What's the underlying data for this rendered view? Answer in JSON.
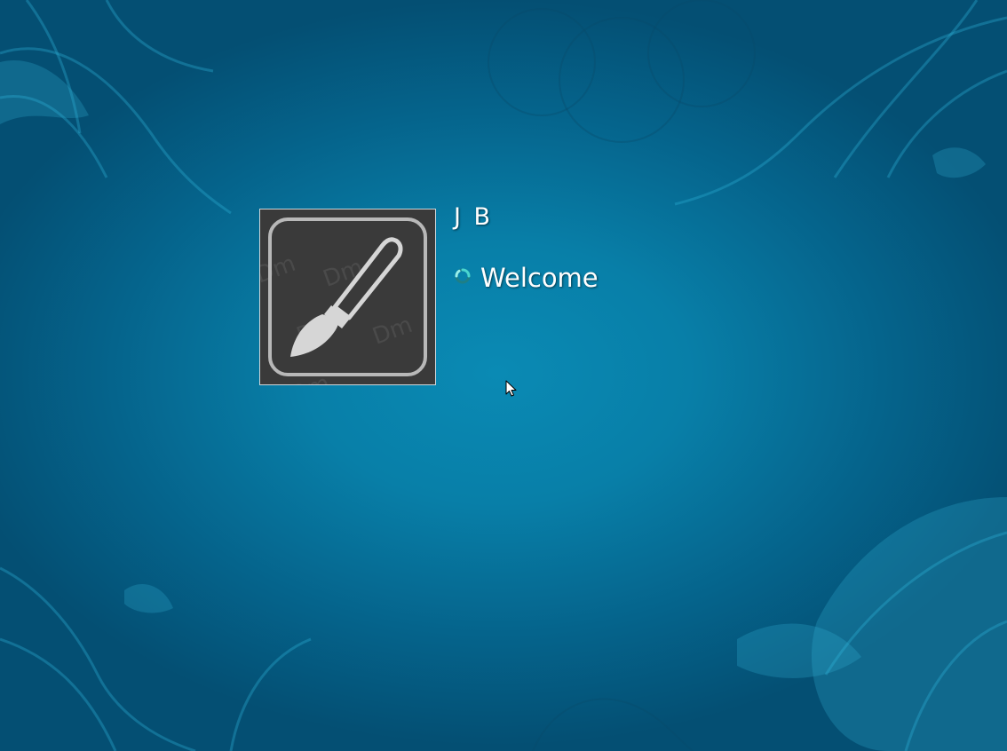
{
  "user": {
    "name": "J B",
    "status": "Welcome"
  },
  "icons": {
    "account_picture": "paintbrush-icon",
    "status_indicator": "busy-spinner-icon",
    "pointer": "mouse-pointer-icon"
  },
  "colors": {
    "background": "#0a8ab4",
    "background_edge": "#044f73",
    "tile_fill": "#3a3a3a",
    "tile_border": "#cfd6da",
    "text": "#ffffff",
    "spinner": "#4ad6d0"
  }
}
